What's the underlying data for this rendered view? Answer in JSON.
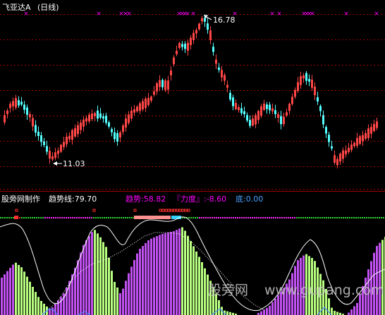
{
  "colors": {
    "up": "#ff4646",
    "down": "#54ffff",
    "grid": "#a00000",
    "divider": "#a00000",
    "marker": "#ff00ff",
    "white": "#ffffff",
    "yellow": "#ffff00",
    "magenta_bar": "#c050f0",
    "green_bar": "#b8ff80",
    "blue_line": "#4488ff",
    "pink": "#ff9090",
    "cyan_blk": "#30d0ff"
  },
  "header": {
    "title": "飞亚达A",
    "period": "(日线)",
    "high_label": "16.78",
    "low_label": "11.03"
  },
  "indicator": {
    "source": "股旁网制作",
    "trend_line": "趋势线:79.70",
    "trend": "趋势:58.82",
    "force": "『力度』:-8.60",
    "bottom": "底:0.00"
  },
  "watermark": {
    "text1": "股旁网",
    "text2": "www.gupang.com"
  },
  "chart_data": {
    "type": "candlestick+histogram",
    "price_max": 16.78,
    "price_min": 11.03,
    "indicator_values": {
      "trend_line": 79.7,
      "trend": 58.82,
      "force": -8.6,
      "bottom": 0.0
    }
  }
}
